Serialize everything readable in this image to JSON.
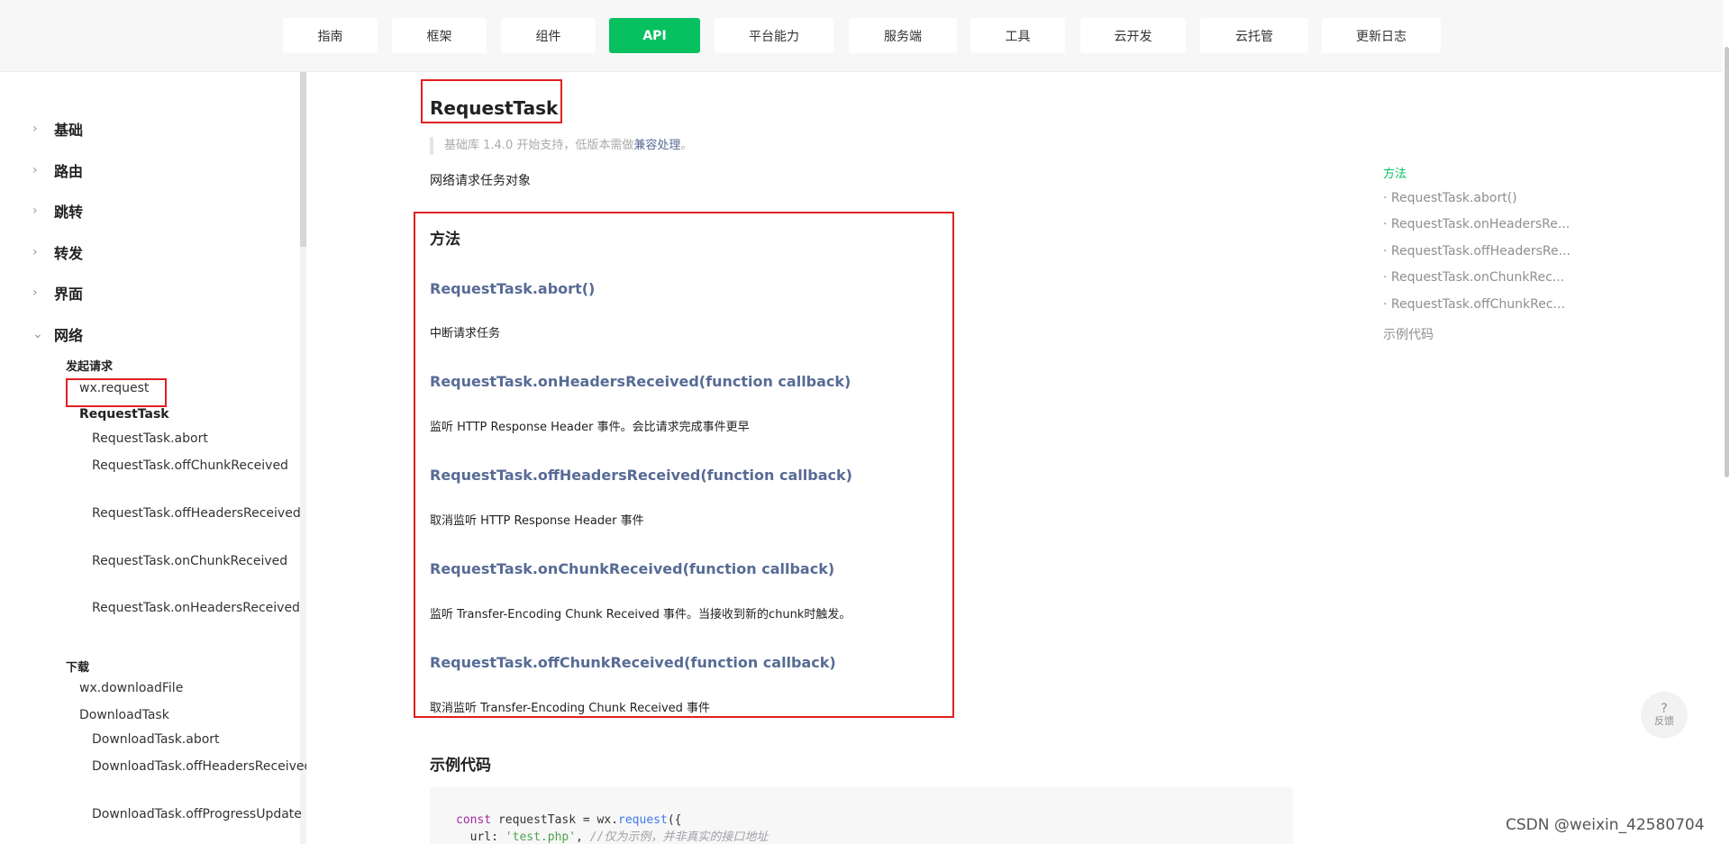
{
  "topnav": {
    "items": [
      "指南",
      "框架",
      "组件",
      "API",
      "平台能力",
      "服务端",
      "工具",
      "云开发",
      "云托管",
      "更新日志"
    ],
    "active": "API",
    "accent": "#07c160"
  },
  "sidebar": {
    "categories": [
      "基础",
      "路由",
      "跳转",
      "转发",
      "界面",
      "网络"
    ],
    "group_request": "发起请求",
    "wx_request": "wx.request",
    "request_task": "RequestTask",
    "request_task_methods": [
      "RequestTask.abort",
      "RequestTask.offChunkReceived",
      "RequestTask.offHeadersReceived",
      "RequestTask.onChunkReceived",
      "RequestTask.onHeadersReceived"
    ],
    "group_download": "下载",
    "wx_download": "wx.downloadFile",
    "download_task": "DownloadTask",
    "download_task_methods": [
      "DownloadTask.abort",
      "DownloadTask.offHeadersReceived",
      "DownloadTask.offProgressUpdate"
    ]
  },
  "main": {
    "title": "RequestTask",
    "support_prefix": "基础库 1.4.0 开始支持，低版本需做",
    "support_link": "兼容处理",
    "support_suffix": "。",
    "intro": "网络请求任务对象",
    "methods_heading": "方法",
    "methods": [
      {
        "name": "RequestTask.abort()",
        "desc": "中断请求任务"
      },
      {
        "name": "RequestTask.onHeadersReceived(function callback)",
        "desc": "监听 HTTP Response Header 事件。会比请求完成事件更早"
      },
      {
        "name": "RequestTask.offHeadersReceived(function callback)",
        "desc": "取消监听 HTTP Response Header 事件"
      },
      {
        "name": "RequestTask.onChunkReceived(function callback)",
        "desc": "监听 Transfer-Encoding Chunk Received 事件。当接收到新的chunk时触发。"
      },
      {
        "name": "RequestTask.offChunkReceived(function callback)",
        "desc": "取消监听 Transfer-Encoding Chunk Received 事件"
      }
    ],
    "example_heading": "示例代码",
    "code": {
      "l1_kw": "const",
      "l1_var": " requestTask = wx.",
      "l1_fn": "request",
      "l1_end": "({",
      "l2_prop": "  url: ",
      "l2_str": "'test.php'",
      "l2_comma": ", ",
      "l2_cmt": "//仅为示例，并非真实的接口地址"
    }
  },
  "toc": {
    "heading": "方法",
    "items": [
      "· RequestTask.abort()",
      "· RequestTask.onHeadersRe...",
      "· RequestTask.offHeadersRe...",
      "· RequestTask.onChunkRec...",
      "· RequestTask.offChunkRec..."
    ],
    "example": "示例代码"
  },
  "feedback": {
    "icon": "?",
    "label": "反馈"
  },
  "watermark": "CSDN @weixin_42580704",
  "annotation_color": "#e02020"
}
